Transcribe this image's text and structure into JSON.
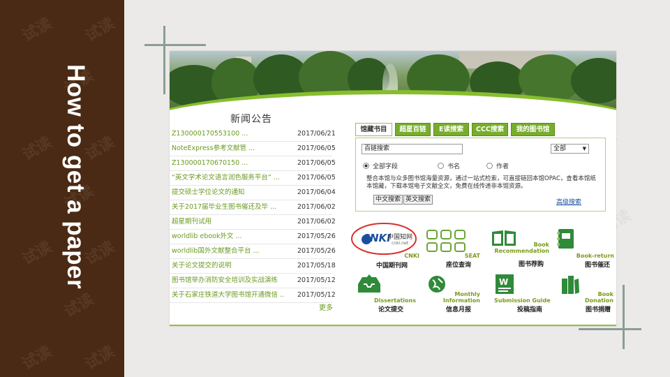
{
  "slide_title": "How to get a paper",
  "watermark": "试读",
  "news": {
    "title": "新闻公告",
    "items": [
      {
        "text": "Z130000170553100 ...",
        "date": "2017/06/21"
      },
      {
        "text": "NoteExpress参考文献管 ...",
        "date": "2017/06/05"
      },
      {
        "text": "Z130000170670150 ...",
        "date": "2017/06/05"
      },
      {
        "text": "“英文学术论文语言润色服务平台” ...",
        "date": "2017/06/05"
      },
      {
        "text": "提交硕士学位论文的通知",
        "date": "2017/06/04"
      },
      {
        "text": "关于2017届毕业生图书催还及毕 ...",
        "date": "2017/06/02"
      },
      {
        "text": "超星期刊试用",
        "date": "2017/06/02"
      },
      {
        "text": "worldlib ebook外文 ...",
        "date": "2017/05/26"
      },
      {
        "text": "worldlib国外文献整合平台 ...",
        "date": "2017/05/26"
      },
      {
        "text": "关于论文提交的说明",
        "date": "2017/05/18"
      },
      {
        "text": "图书馆举办消防安全培训及实战演练",
        "date": "2017/05/12"
      },
      {
        "text": "关于石家庄铁道大学图书馆开通微信 ...",
        "date": "2017/05/12"
      }
    ],
    "more": "更多"
  },
  "search": {
    "tabs": [
      "馆藏书目",
      "超星百链",
      "E读搜索",
      "CCC搜索",
      "我的图书馆"
    ],
    "input_value": "百链搜索",
    "select_value": "全部",
    "radios": [
      "全部字段",
      "书名",
      "作者"
    ],
    "description": "整合本馆与众多图书馆海量资源，通过一站式检索，可直接链回本馆OPAC，查看本馆纸本馆藏，下载本馆电子文献全文，免费在线传递非本馆资源。",
    "buttons": [
      "中文搜索",
      "英文搜索"
    ],
    "advanced": "高级搜索"
  },
  "services": {
    "cnki_logo": "中国知网",
    "cnki_url": "cnki.net",
    "cnki_label": "CNKI",
    "cnki_cn": "中国期刊网",
    "seat_label": "SEAT",
    "seat_cn": "座位查询",
    "book_rec_label": "Book Recommendation",
    "book_rec_cn": "图书荐购",
    "book_return_label": "Book-return",
    "book_return_cn": "图书催还",
    "dissertations_label": "Dissertations",
    "dissertations_cn": "论文提交",
    "monthly_label": "Monthly Information",
    "monthly_cn": "信息月报",
    "submission_label": "Submission Guide",
    "submission_cn": "投稿指南",
    "donation_label": "Book Donation",
    "donation_cn": "图书捐赠"
  },
  "colors": {
    "brown_band": "#4a2a14",
    "accent_green": "#78ad2c",
    "link_green": "#6a9a1f",
    "cnki_circle": "#d9302c",
    "cross_lines": "#8a9d95"
  }
}
